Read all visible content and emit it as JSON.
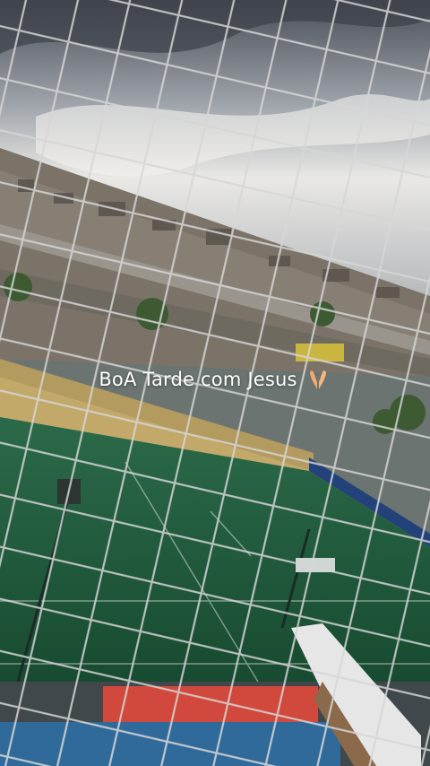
{
  "caption": {
    "text": "BoA Tarde com Jesus",
    "emoji": "praying-hands-icon"
  },
  "colors": {
    "sky": "#c9ccd0",
    "field": "#1f5a3c",
    "net": "#d9d9d9"
  }
}
